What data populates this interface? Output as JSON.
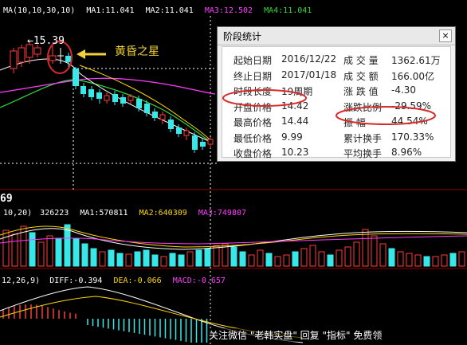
{
  "colors": {
    "background": "#000000",
    "up": "#ff3b3b",
    "down": "#38e8e8",
    "ma_white": "#ffffff",
    "ma_yellow": "#ffd700",
    "ma_magenta": "#ff3cff",
    "ma_green": "#34d838",
    "accent_red": "#d72a2a",
    "annot_yellow": "#f2d23a"
  },
  "price_ma": {
    "params": "MA(10,10,30,10)",
    "ma1": "MA1:11.041",
    "ma2": "MA2:11.041",
    "ma3": "MA3:12.502",
    "ma4": "MA4:11.041"
  },
  "price_marker": "←15.39",
  "price_low_label": "69",
  "annotation_label": "黄昏之星",
  "vol_ma": {
    "params": "10,20)",
    "vol": "326223",
    "ma1": "MA1:570811",
    "ma2": "MA2:640309",
    "ma3": "MA3:749807"
  },
  "macd": {
    "params": "12,26,9)",
    "diff": "DIFF:-0.394",
    "dea": "DEA:-0.066",
    "macd": "MACD:-0.657"
  },
  "panel": {
    "title": "阶段统计",
    "close": "×",
    "left": [
      {
        "label": "起始日期",
        "value": "2016/12/22"
      },
      {
        "label": "终止日期",
        "value": "2017/01/18"
      },
      {
        "label": "时段长度",
        "value": "19周期"
      },
      {
        "label": "开盘价格",
        "value": "14.42"
      },
      {
        "label": "最高价格",
        "value": "14.44"
      },
      {
        "label": "最低价格",
        "value": "9.99"
      },
      {
        "label": "收盘价格",
        "value": "10.23"
      }
    ],
    "right": [
      {
        "label": "成 交 量",
        "value": "1362.61万"
      },
      {
        "label": "成 交 额",
        "value": "166.00亿"
      },
      {
        "label": "涨 跌 值",
        "value": "-4.30"
      },
      {
        "label": "涨跌比例",
        "value": "-29.59%"
      },
      {
        "label": "振     幅",
        "value": "44.54%"
      },
      {
        "label": "累计换手",
        "value": "170.33%"
      },
      {
        "label": "平均换手",
        "value": "8.96%"
      }
    ]
  },
  "watermark": "关注微信 \"老韩实盘\" 回复 \"指标\" 免费领"
}
